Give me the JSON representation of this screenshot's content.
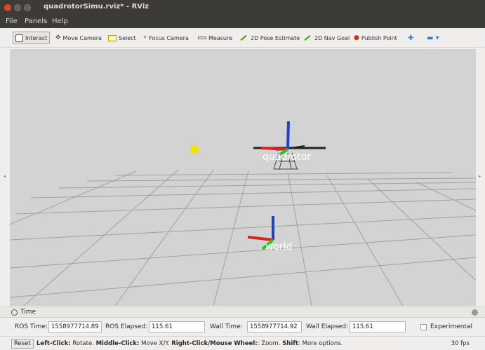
{
  "window": {
    "title": "quadrotorSimu.rviz* - RViz"
  },
  "menu": {
    "file": "File",
    "panels": "Panels",
    "help": "Help"
  },
  "toolbar": {
    "tools": [
      {
        "label": "Interact",
        "icon": "interact-icon"
      },
      {
        "label": "Move Camera",
        "icon": "move-camera-icon"
      },
      {
        "label": "Select",
        "icon": "select-icon"
      },
      {
        "label": "Focus Camera",
        "icon": "focus-camera-icon"
      },
      {
        "label": "Measure",
        "icon": "measure-icon"
      },
      {
        "label": "2D Pose Estimate",
        "icon": "pose-estimate-icon"
      },
      {
        "label": "2D Nav Goal",
        "icon": "nav-goal-icon"
      },
      {
        "label": "Publish Point",
        "icon": "publish-point-icon"
      }
    ],
    "extra_icons": [
      "add-tool-icon",
      "remove-tool-icon"
    ]
  },
  "viewport": {
    "labels": {
      "robot": "quadrotor",
      "world": "world"
    },
    "colors": {
      "background": "#d3d3d3",
      "grid": "#a0a0a0",
      "x_axis": "#e02020",
      "y_axis": "#1ec81e",
      "z_axis": "#2040d0",
      "marker": "#f2e200"
    }
  },
  "time_panel": {
    "title": "Time",
    "ros_time_label": "ROS Time:",
    "ros_time": "1558977714.89",
    "ros_elapsed_label": "ROS Elapsed:",
    "ros_elapsed": "115.61",
    "wall_time_label": "Wall Time:",
    "wall_time": "1558977714.92",
    "wall_elapsed_label": "Wall Elapsed:",
    "wall_elapsed": "115.61",
    "experimental_label": "Experimental"
  },
  "status": {
    "reset": "Reset",
    "hint_parts": [
      {
        "text": "Left-Click:",
        "bold": true
      },
      {
        "text": " Rotate. ",
        "bold": false
      },
      {
        "text": "Middle-Click:",
        "bold": true
      },
      {
        "text": " Move X/Y. ",
        "bold": false
      },
      {
        "text": "Right-Click/Mouse Wheel:",
        "bold": true
      },
      {
        "text": ": Zoom. ",
        "bold": false
      },
      {
        "text": "Shift",
        "bold": true
      },
      {
        "text": ": More options.",
        "bold": false
      }
    ],
    "fps": "30 fps"
  }
}
